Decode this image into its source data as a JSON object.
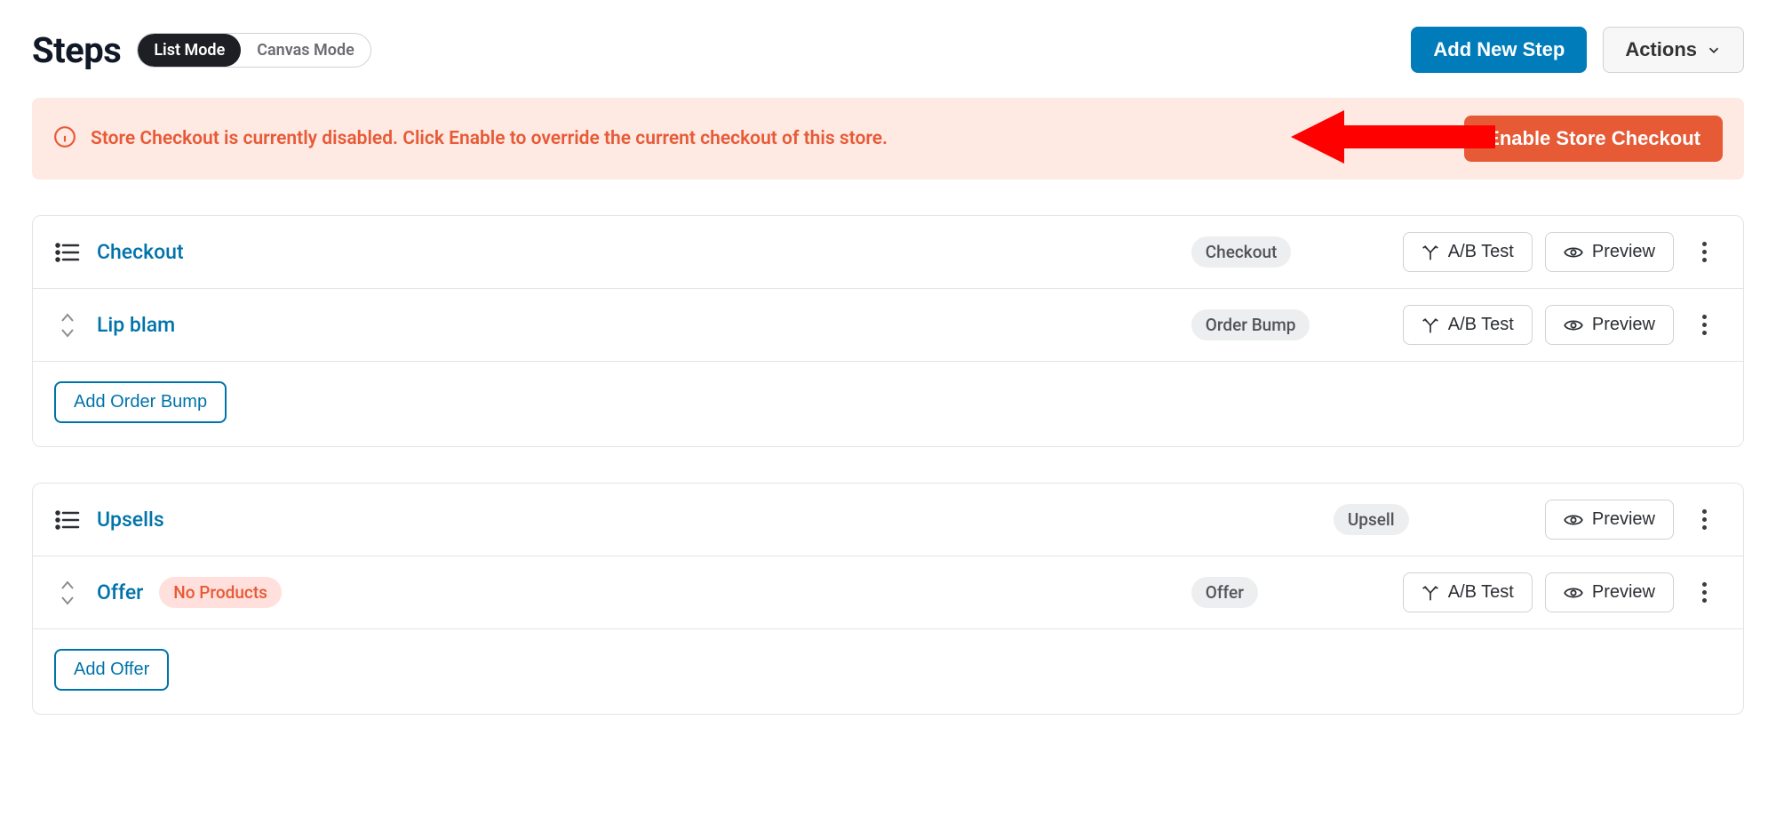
{
  "header": {
    "title": "Steps",
    "mode_list": "List Mode",
    "mode_canvas": "Canvas Mode",
    "add_step": "Add New Step",
    "actions": "Actions"
  },
  "banner": {
    "text": "Store Checkout is currently disabled. Click Enable to override the current checkout of this store.",
    "button": "Enable Store Checkout"
  },
  "btn": {
    "abtest": "A/B Test",
    "preview": "Preview"
  },
  "group1": {
    "main": {
      "title": "Checkout",
      "tag": "Checkout"
    },
    "sub": {
      "title": "Lip blam",
      "tag": "Order Bump"
    },
    "add": "Add Order Bump"
  },
  "group2": {
    "main": {
      "title": "Upsells",
      "tag": "Upsell"
    },
    "sub": {
      "title": "Offer",
      "tag": "Offer",
      "warn": "No Products"
    },
    "add": "Add Offer"
  }
}
